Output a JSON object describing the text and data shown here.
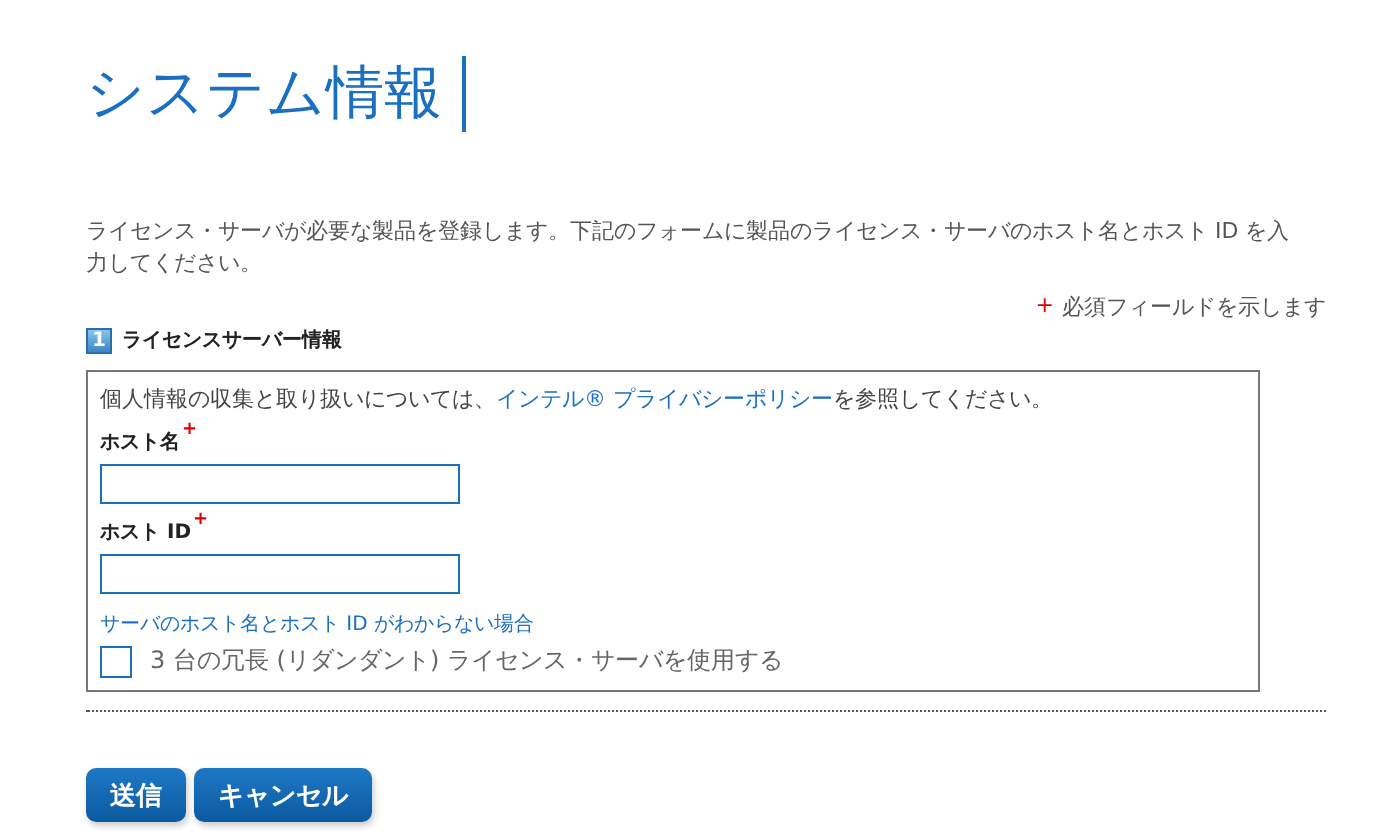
{
  "title": "システム情報",
  "description": "ライセンス・サーバが必要な製品を登録します。下記のフォームに製品のライセンス・サーバのホスト名とホスト ID を入力してください。",
  "required_note": {
    "mark": "+",
    "text": "必須フィールドを示します"
  },
  "section": {
    "number": "1",
    "title": "ライセンスサーバー情報"
  },
  "privacy": {
    "before": "個人情報の収集と取り扱いについては、",
    "link": "インテル® プライバシーポリシー",
    "after": "を参照してください。"
  },
  "fields": [
    {
      "label": "ホスト名",
      "required_mark": "+"
    },
    {
      "label": "ホスト ID",
      "required_mark": "+"
    }
  ],
  "help_link": "サーバのホスト名とホスト ID がわからない場合",
  "redundant": {
    "label": "3 台の冗長 (リダンダント) ライセンス・サーバを使用する",
    "checked": false
  },
  "buttons": [
    "送信",
    "キャンセル"
  ]
}
